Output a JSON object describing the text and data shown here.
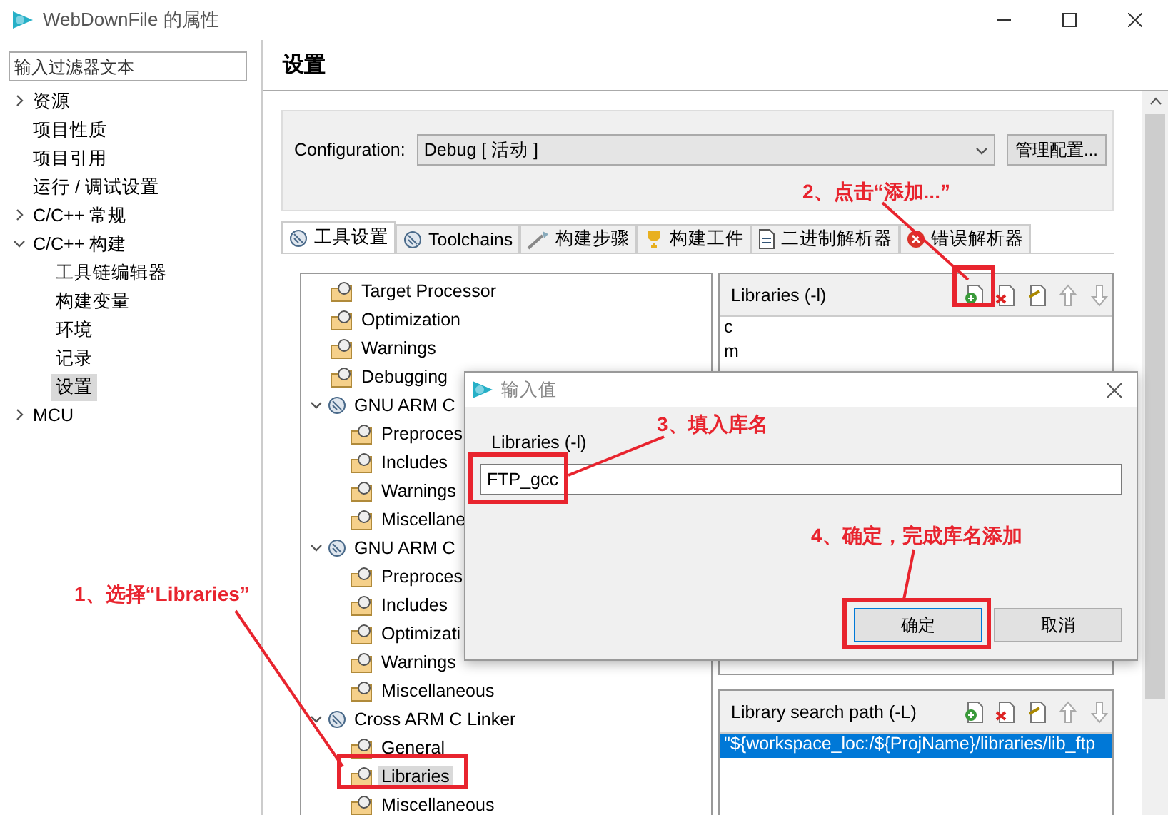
{
  "window": {
    "title": "WebDownFile 的属性"
  },
  "filter": {
    "placeholder": "输入过滤器文本"
  },
  "nav": [
    {
      "label": "资源",
      "expanded": false,
      "selected": false
    },
    {
      "label": "项目性质",
      "selected": false
    },
    {
      "label": "项目引用",
      "selected": false
    },
    {
      "label": "运行 / 调试设置",
      "selected": false
    },
    {
      "label": "C/C++ 常规",
      "expanded": false,
      "selected": false
    },
    {
      "label": "C/C++ 构建",
      "expanded": true,
      "selected": false,
      "children": [
        {
          "label": "工具链编辑器",
          "selected": false
        },
        {
          "label": "构建变量",
          "selected": false
        },
        {
          "label": "环境",
          "selected": false
        },
        {
          "label": "记录",
          "selected": false
        },
        {
          "label": "设置",
          "selected": true
        }
      ]
    },
    {
      "label": "MCU",
      "expanded": false,
      "selected": false
    }
  ],
  "page_title": "设置",
  "configuration": {
    "label": "Configuration:",
    "value": "Debug  [ 活动 ]",
    "manage_button": "管理配置..."
  },
  "tabs": [
    {
      "label": "工具设置",
      "kind": "gear",
      "selected": true
    },
    {
      "label": "Toolchains",
      "kind": "gear",
      "selected": false
    },
    {
      "label": "构建步骤",
      "kind": "wand",
      "selected": false
    },
    {
      "label": "构建工件",
      "kind": "trophy",
      "selected": false
    },
    {
      "label": "二进制解析器",
      "kind": "binary",
      "selected": false
    },
    {
      "label": "错误解析器",
      "kind": "error",
      "selected": false
    }
  ],
  "tool_tree": [
    {
      "label": "Target Processor",
      "kind": "option",
      "selected": false
    },
    {
      "label": "Optimization",
      "kind": "option",
      "selected": false
    },
    {
      "label": "Warnings",
      "kind": "option",
      "selected": false
    },
    {
      "label": "Debugging",
      "kind": "option",
      "selected": false
    },
    {
      "label": "GNU ARM C",
      "kind": "tool",
      "expanded": true,
      "children": [
        {
          "label": "Preproces",
          "selected": false
        },
        {
          "label": "Includes",
          "selected": false
        },
        {
          "label": "Warnings",
          "selected": false
        },
        {
          "label": "Miscellane",
          "selected": false
        }
      ]
    },
    {
      "label": "GNU ARM C",
      "kind": "tool",
      "expanded": true,
      "children": [
        {
          "label": "Preproces",
          "selected": false
        },
        {
          "label": "Includes",
          "selected": false
        },
        {
          "label": "Optimizati",
          "selected": false
        },
        {
          "label": "Warnings",
          "selected": false
        },
        {
          "label": "Miscellaneous",
          "selected": false
        }
      ]
    },
    {
      "label": "Cross ARM C Linker",
      "kind": "tool",
      "expanded": true,
      "children": [
        {
          "label": "General",
          "selected": false
        },
        {
          "label": "Libraries",
          "selected": true
        },
        {
          "label": "Miscellaneous",
          "selected": false
        }
      ]
    }
  ],
  "libraries": {
    "title": "Libraries (-l)",
    "items": [
      {
        "label": "c",
        "selected": false
      },
      {
        "label": "m",
        "selected": false
      }
    ]
  },
  "library_paths": {
    "title": "Library search path (-L)",
    "items": [
      {
        "label": "\"${workspace_loc:/${ProjName}/libraries/lib_ftp",
        "selected": true
      }
    ]
  },
  "dialog": {
    "title": "输入值",
    "label": "Libraries (-l)",
    "value": "FTP_gcc",
    "ok": "确定",
    "cancel": "取消"
  },
  "annotations": [
    {
      "text": "1、选择“Libraries”",
      "kind": "tree"
    },
    {
      "text": "2、点击“添加...”",
      "kind": "add"
    },
    {
      "text": "3、填入库名",
      "kind": "field"
    },
    {
      "text": "4、确定，完成库名添加",
      "kind": "ok"
    }
  ]
}
